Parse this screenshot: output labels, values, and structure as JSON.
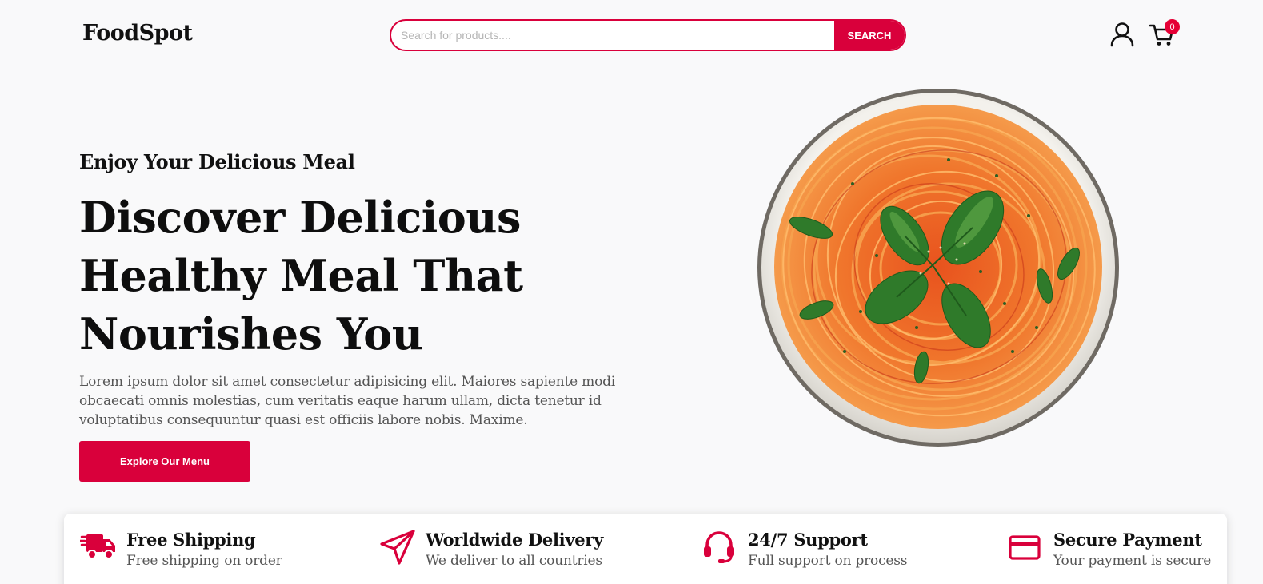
{
  "header": {
    "logo": "FoodSpot",
    "search_placeholder": "Search for products....",
    "search_button": "SEARCH",
    "cart_count": "0"
  },
  "hero": {
    "eyebrow": "Enjoy Your Delicious Meal",
    "headline_lines": [
      "Discover Delicious",
      "Healthy Meal That",
      "Nourishes You"
    ],
    "description": "Lorem ipsum dolor sit amet consectetur adipisicing elit. Maiores sapiente modi obcaecati omnis molestias, cum veritatis eaque harum ullam, dicta tenetur id voluptatibus consequuntur quasi est officiis labore nobis. Maxime.",
    "cta_label": "Explore Our Menu"
  },
  "features": [
    {
      "icon": "truck-icon",
      "title": "Free Shipping",
      "subtitle": "Free shipping on order"
    },
    {
      "icon": "paper-plane-icon",
      "title": "Worldwide Delivery",
      "subtitle": "We deliver to all countries"
    },
    {
      "icon": "headset-icon",
      "title": "24/7 Support",
      "subtitle": "Full support on process"
    },
    {
      "icon": "credit-card-icon",
      "title": "Secure Payment",
      "subtitle": "Your payment is secure"
    }
  ],
  "colors": {
    "accent": "#d9003b",
    "background": "#f9f9fa",
    "text": "#111111",
    "muted_text": "#555555"
  }
}
